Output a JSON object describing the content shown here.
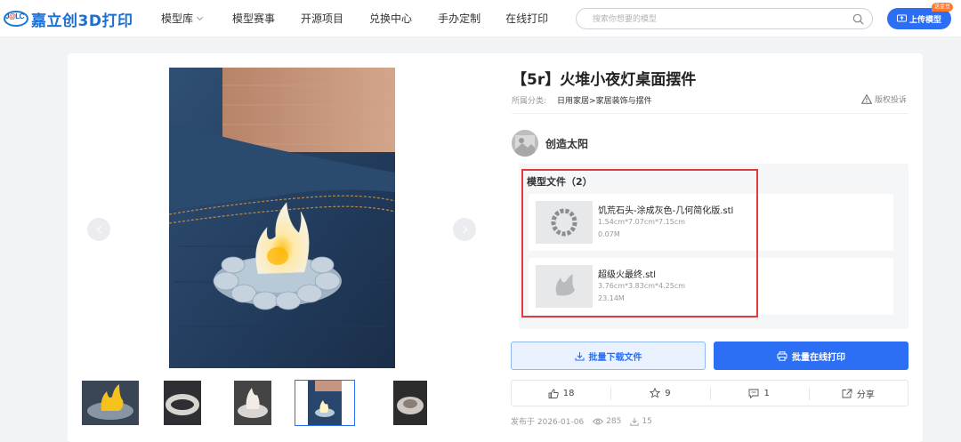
{
  "header": {
    "logo_text": "嘉立创3D打印",
    "logo_mark_left": "J",
    "logo_mark_o": "@",
    "logo_mark_right": "LC",
    "nav": [
      {
        "label": "模型库",
        "has_dropdown": true
      },
      {
        "label": "模型赛事"
      },
      {
        "label": "开源项目"
      },
      {
        "label": "兑换中心"
      },
      {
        "label": "手办定制"
      },
      {
        "label": "在线打印"
      }
    ],
    "search_placeholder": "搜索你想要的模型",
    "upload_label": "上传模型",
    "upload_badge": "送金豆",
    "accent_color": "#2c6ff5"
  },
  "gallery": {
    "prev_icon": "chevron-left-icon",
    "next_icon": "chevron-right-icon",
    "thumbnail_count": 5,
    "active_thumbnail": 4
  },
  "model": {
    "title": "【5r】火堆小夜灯桌面摆件",
    "category_label": "所属分类:",
    "category_path": "日用家居>家居装饰与摆件",
    "report_label": "版权投诉",
    "author_name": "创造太阳"
  },
  "files": {
    "title": "模型文件（2）",
    "highlight_color": "#e23b3b",
    "items": [
      {
        "name": "饥荒石头-涂成灰色-几何简化版.stl",
        "dims": "1.54cm*7.07cm*7.15cm",
        "size": "0.07M"
      },
      {
        "name": "超级火最终.stl",
        "dims": "3.76cm*3.83cm*4.25cm",
        "size": "23.14M"
      }
    ]
  },
  "buttons": {
    "download_label": "批量下载文件",
    "print_label": "批量在线打印"
  },
  "actions": {
    "likes": "18",
    "stars": "9",
    "comments": "1",
    "share_label": "分享"
  },
  "meta": {
    "published": "发布于 2026-01-06",
    "views": "285",
    "downloads": "15"
  }
}
